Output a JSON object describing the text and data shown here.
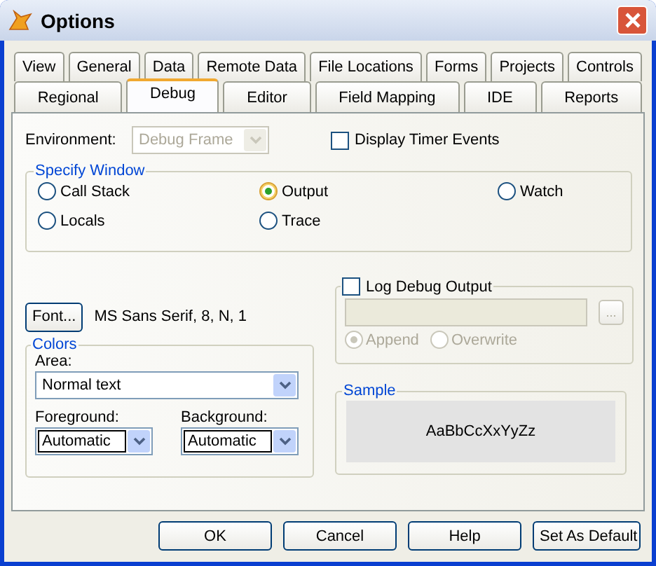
{
  "window": {
    "title": "Options"
  },
  "tabs_row1": [
    {
      "label": "View",
      "selected": false
    },
    {
      "label": "General",
      "selected": false
    },
    {
      "label": "Data",
      "selected": false
    },
    {
      "label": "Remote Data",
      "selected": false
    },
    {
      "label": "File Locations",
      "selected": false
    },
    {
      "label": "Forms",
      "selected": false
    },
    {
      "label": "Projects",
      "selected": false
    },
    {
      "label": "Controls",
      "selected": false
    }
  ],
  "tabs_row2": [
    {
      "label": "Regional",
      "selected": false
    },
    {
      "label": "Debug",
      "selected": true
    },
    {
      "label": "Editor",
      "selected": false
    },
    {
      "label": "Field Mapping",
      "selected": false
    },
    {
      "label": "IDE",
      "selected": false
    },
    {
      "label": "Reports",
      "selected": false
    }
  ],
  "environment": {
    "label": "Environment:",
    "value": "Debug Frame",
    "disabled": true
  },
  "display_timer_events": {
    "label": "Display Timer Events",
    "checked": false
  },
  "specify_window": {
    "title": "Specify Window",
    "options": [
      {
        "label": "Call Stack",
        "selected": false
      },
      {
        "label": "Output",
        "selected": true
      },
      {
        "label": "Watch",
        "selected": false
      },
      {
        "label": "Locals",
        "selected": false
      },
      {
        "label": "Trace",
        "selected": false
      }
    ]
  },
  "font": {
    "button": "Font...",
    "value": "MS Sans Serif, 8, N, 1"
  },
  "colors": {
    "title": "Colors",
    "area_label": "Area:",
    "area_value": "Normal text",
    "foreground_label": "Foreground:",
    "foreground_value": "Automatic",
    "background_label": "Background:",
    "background_value": "Automatic"
  },
  "log_debug_output": {
    "label": "Log Debug Output",
    "checked": false,
    "browse_button": "...",
    "modes": [
      {
        "label": "Append",
        "selected": true
      },
      {
        "label": "Overwrite",
        "selected": false
      }
    ]
  },
  "sample": {
    "title": "Sample",
    "text": "AaBbCcXxYyZz"
  },
  "buttons": [
    "OK",
    "Cancel",
    "Help",
    "Set As Default"
  ]
}
